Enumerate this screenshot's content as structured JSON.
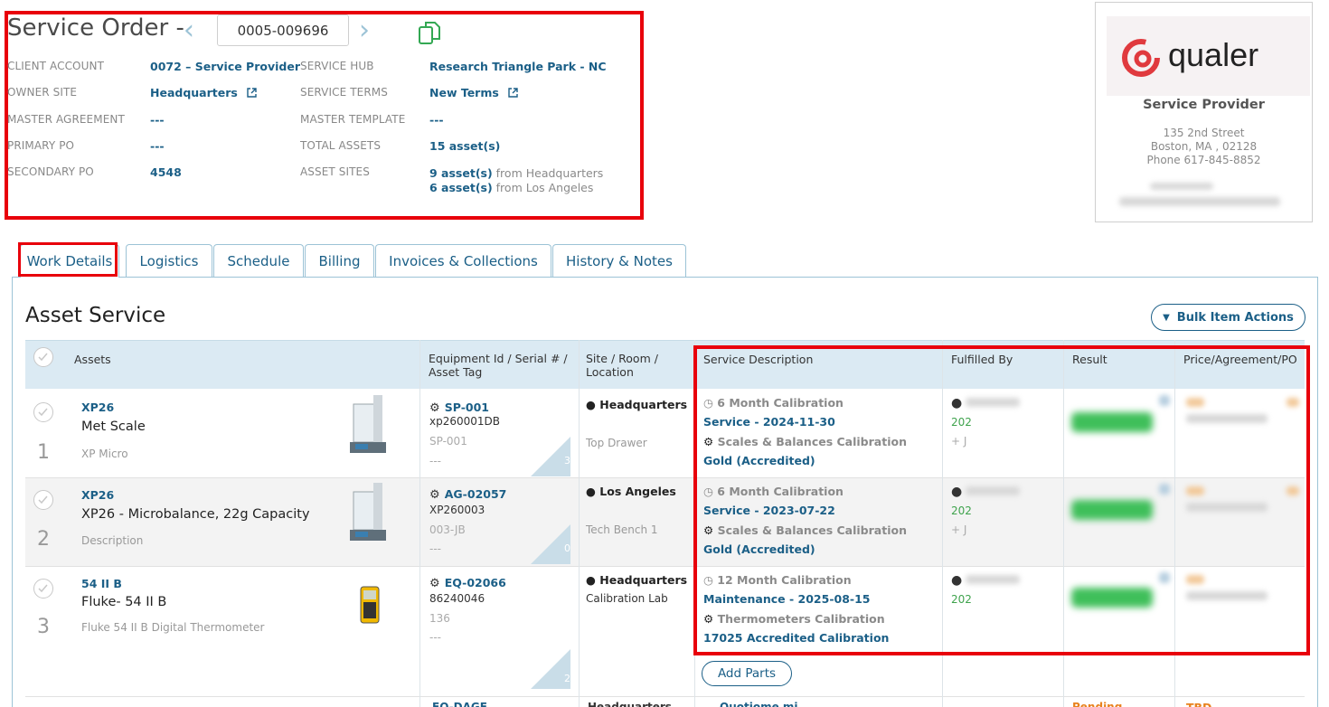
{
  "header": {
    "title": "Service Order -",
    "order_number": "0005-009696",
    "fields": {
      "client_account_label": "CLIENT ACCOUNT",
      "client_account_value": "0072 – Service Provider",
      "owner_site_label": "OWNER SITE",
      "owner_site_value": "Headquarters",
      "master_agreement_label": "MASTER AGREEMENT",
      "master_agreement_value": "---",
      "primary_po_label": "PRIMARY PO",
      "primary_po_value": "---",
      "secondary_po_label": "SECONDARY PO",
      "secondary_po_value": "4548",
      "service_hub_label": "SERVICE HUB",
      "service_hub_value": "Research Triangle Park - NC",
      "service_terms_label": "SERVICE TERMS",
      "service_terms_value": "New Terms",
      "master_template_label": "MASTER TEMPLATE",
      "master_template_value": "---",
      "total_assets_label": "TOTAL ASSETS",
      "total_assets_value": "15 asset(s)",
      "asset_sites_label": "ASSET SITES",
      "asset_sites_line1_count": "9 asset(s)",
      "asset_sites_line1_rest": " from Headquarters",
      "asset_sites_line2_count": "6 asset(s)",
      "asset_sites_line2_rest": " from Los Angeles"
    }
  },
  "provider": {
    "logo_text": "qualer",
    "name": "Service Provider",
    "address1": "135 2nd Street",
    "address2": "Boston, MA , 02128",
    "phone": "Phone 617-845-8852"
  },
  "tabs": [
    {
      "label": "Work Details"
    },
    {
      "label": "Logistics"
    },
    {
      "label": "Schedule"
    },
    {
      "label": "Billing"
    },
    {
      "label": "Invoices & Collections"
    },
    {
      "label": "History & Notes"
    }
  ],
  "section": {
    "title": "Asset Service",
    "bulk_actions_label": "Bulk Item Actions",
    "add_parts_label": "Add Parts"
  },
  "table": {
    "columns": {
      "assets": "Assets",
      "equipment": "Equipment Id / Serial # / Asset Tag",
      "site": "Site / Room / Location",
      "service": "Service Description",
      "fulfilled": "Fulfilled By",
      "result": "Result",
      "price": "Price/Agreement/PO"
    },
    "rows": [
      {
        "num": "1",
        "code": "XP26",
        "name": "Met Scale",
        "sub": "XP Micro",
        "equip_id": "SP-001",
        "serial": "xp260001DB",
        "asset_tag": "SP-001",
        "extra": "---",
        "corner_count": "3",
        "site": "Headquarters",
        "room": "Top Drawer",
        "interval": "6 Month Calibration",
        "service": "Service - 2024-11-30",
        "category": "Scales & Balances Calibration",
        "level": "Gold (Accredited)",
        "fulfilled_partial": "202",
        "fulfilled_partial2": "+ J"
      },
      {
        "num": "2",
        "code": "XP26",
        "name": "XP26 - Microbalance, 22g Capacity",
        "sub": "Description",
        "equip_id": "AG-02057",
        "serial": "XP260003",
        "asset_tag": "003-JB",
        "extra": "---",
        "corner_count": "0",
        "site": "Los Angeles",
        "room": "Tech Bench 1",
        "interval": "6 Month Calibration",
        "service": "Service - 2023-07-22",
        "category": "Scales & Balances Calibration",
        "level": "Gold (Accredited)",
        "fulfilled_partial": "202",
        "fulfilled_partial2": "+ J"
      },
      {
        "num": "3",
        "code": "54 II B",
        "name": "Fluke- 54 II B",
        "sub": "Fluke 54 II B Digital Thermometer",
        "equip_id": "EQ-02066",
        "serial": "86240046",
        "asset_tag": "136",
        "extra": "---",
        "corner_count": "2",
        "site": "Headquarters",
        "room": "Calibration Lab",
        "interval": "12 Month Calibration",
        "service": "Maintenance - 2025-08-15",
        "category": "Thermometers Calibration",
        "level": "17025 Accredited Calibration",
        "fulfilled_partial": "202",
        "fulfilled_partial2": ""
      }
    ],
    "partial_row": {
      "equip_id": "EQ-DAGE",
      "site": "Headquarters",
      "interval": "Quotiome mi...",
      "result": "Pending",
      "price": "TBD"
    }
  },
  "colors": {
    "accent": "#1b5f87",
    "tab_border": "#9cc3d6",
    "highlight_red": "#e8000b",
    "header_bg": "#dbeaf3",
    "logo_red": "#e03a3e"
  }
}
